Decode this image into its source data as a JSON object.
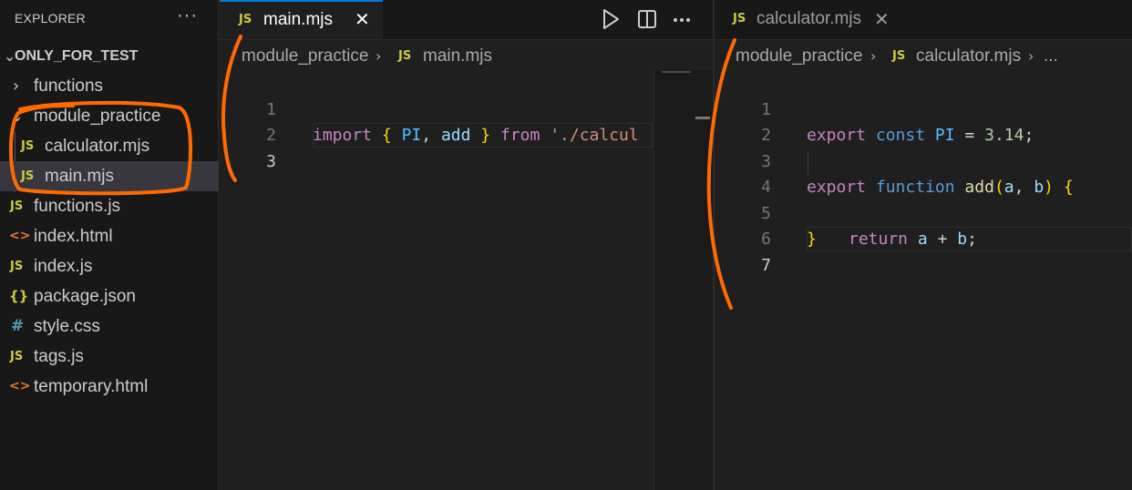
{
  "explorer": {
    "title": "EXPLORER",
    "more_icon": "ellipsis-icon",
    "root": "ONLY_FOR_TEST",
    "items": [
      {
        "label": "functions",
        "icon": "chevron-right-icon",
        "type": "folder"
      },
      {
        "label": "module_practice",
        "icon": "chevron-down-icon",
        "type": "folder"
      },
      {
        "label": "calculator.mjs",
        "icon": "JS",
        "type": "file"
      },
      {
        "label": "main.mjs",
        "icon": "JS",
        "type": "file",
        "selected": true
      },
      {
        "label": "functions.js",
        "icon": "JS",
        "type": "file"
      },
      {
        "label": "index.html",
        "icon": "<>",
        "type": "file"
      },
      {
        "label": "index.js",
        "icon": "JS",
        "type": "file"
      },
      {
        "label": "package.json",
        "icon": "{}",
        "type": "file"
      },
      {
        "label": "style.css",
        "icon": "#",
        "type": "file"
      },
      {
        "label": "tags.js",
        "icon": "JS",
        "type": "file"
      },
      {
        "label": "temporary.html",
        "icon": "<>",
        "type": "file"
      }
    ]
  },
  "left_editor": {
    "tab": {
      "label": "main.mjs",
      "icon": "JS",
      "close": "✕"
    },
    "actions": [
      "run-icon",
      "split-editor-icon",
      "ellipsis-icon"
    ],
    "breadcrumb": {
      "folder": "module_practice",
      "file_icon": "JS",
      "file": "main.mjs"
    },
    "line_numbers": [
      "1",
      "2",
      "3"
    ],
    "current_line": "3",
    "code_line1": {
      "kw": "import",
      "lb": "{",
      "a": "PI",
      "comma": ",",
      "b": "add",
      "rb": "}",
      "from": "from",
      "str": "'./calcul"
    }
  },
  "right_editor": {
    "tab": {
      "label": "calculator.mjs",
      "icon": "JS",
      "close": "✕"
    },
    "breadcrumb": {
      "folder": "module_practice",
      "file_icon": "JS",
      "file": "calculator.mjs",
      "more": "..."
    },
    "line_numbers": [
      "1",
      "2",
      "3",
      "4",
      "5",
      "6",
      "7"
    ],
    "current_line": "7",
    "code": {
      "l1": {
        "export": "export",
        "const": "const",
        "name": "PI",
        "eq": "=",
        "value": "3.14",
        "semi": ";"
      },
      "l3": {
        "export": "export",
        "function": "function",
        "name": "add",
        "lp": "(",
        "a": "a",
        "comma": ",",
        "b": "b",
        "rp": ")",
        "lb": "{"
      },
      "l4": {
        "return": "return",
        "a": "a",
        "plus": "+",
        "b": "b",
        "semi": ";"
      },
      "l5": {
        "rb": "}"
      }
    }
  },
  "colors": {
    "accent": "#0078d4",
    "annotation": "#ff6a00",
    "js_icon": "#cbcb41",
    "html_icon": "#e37933",
    "css_icon": "#519aba"
  }
}
